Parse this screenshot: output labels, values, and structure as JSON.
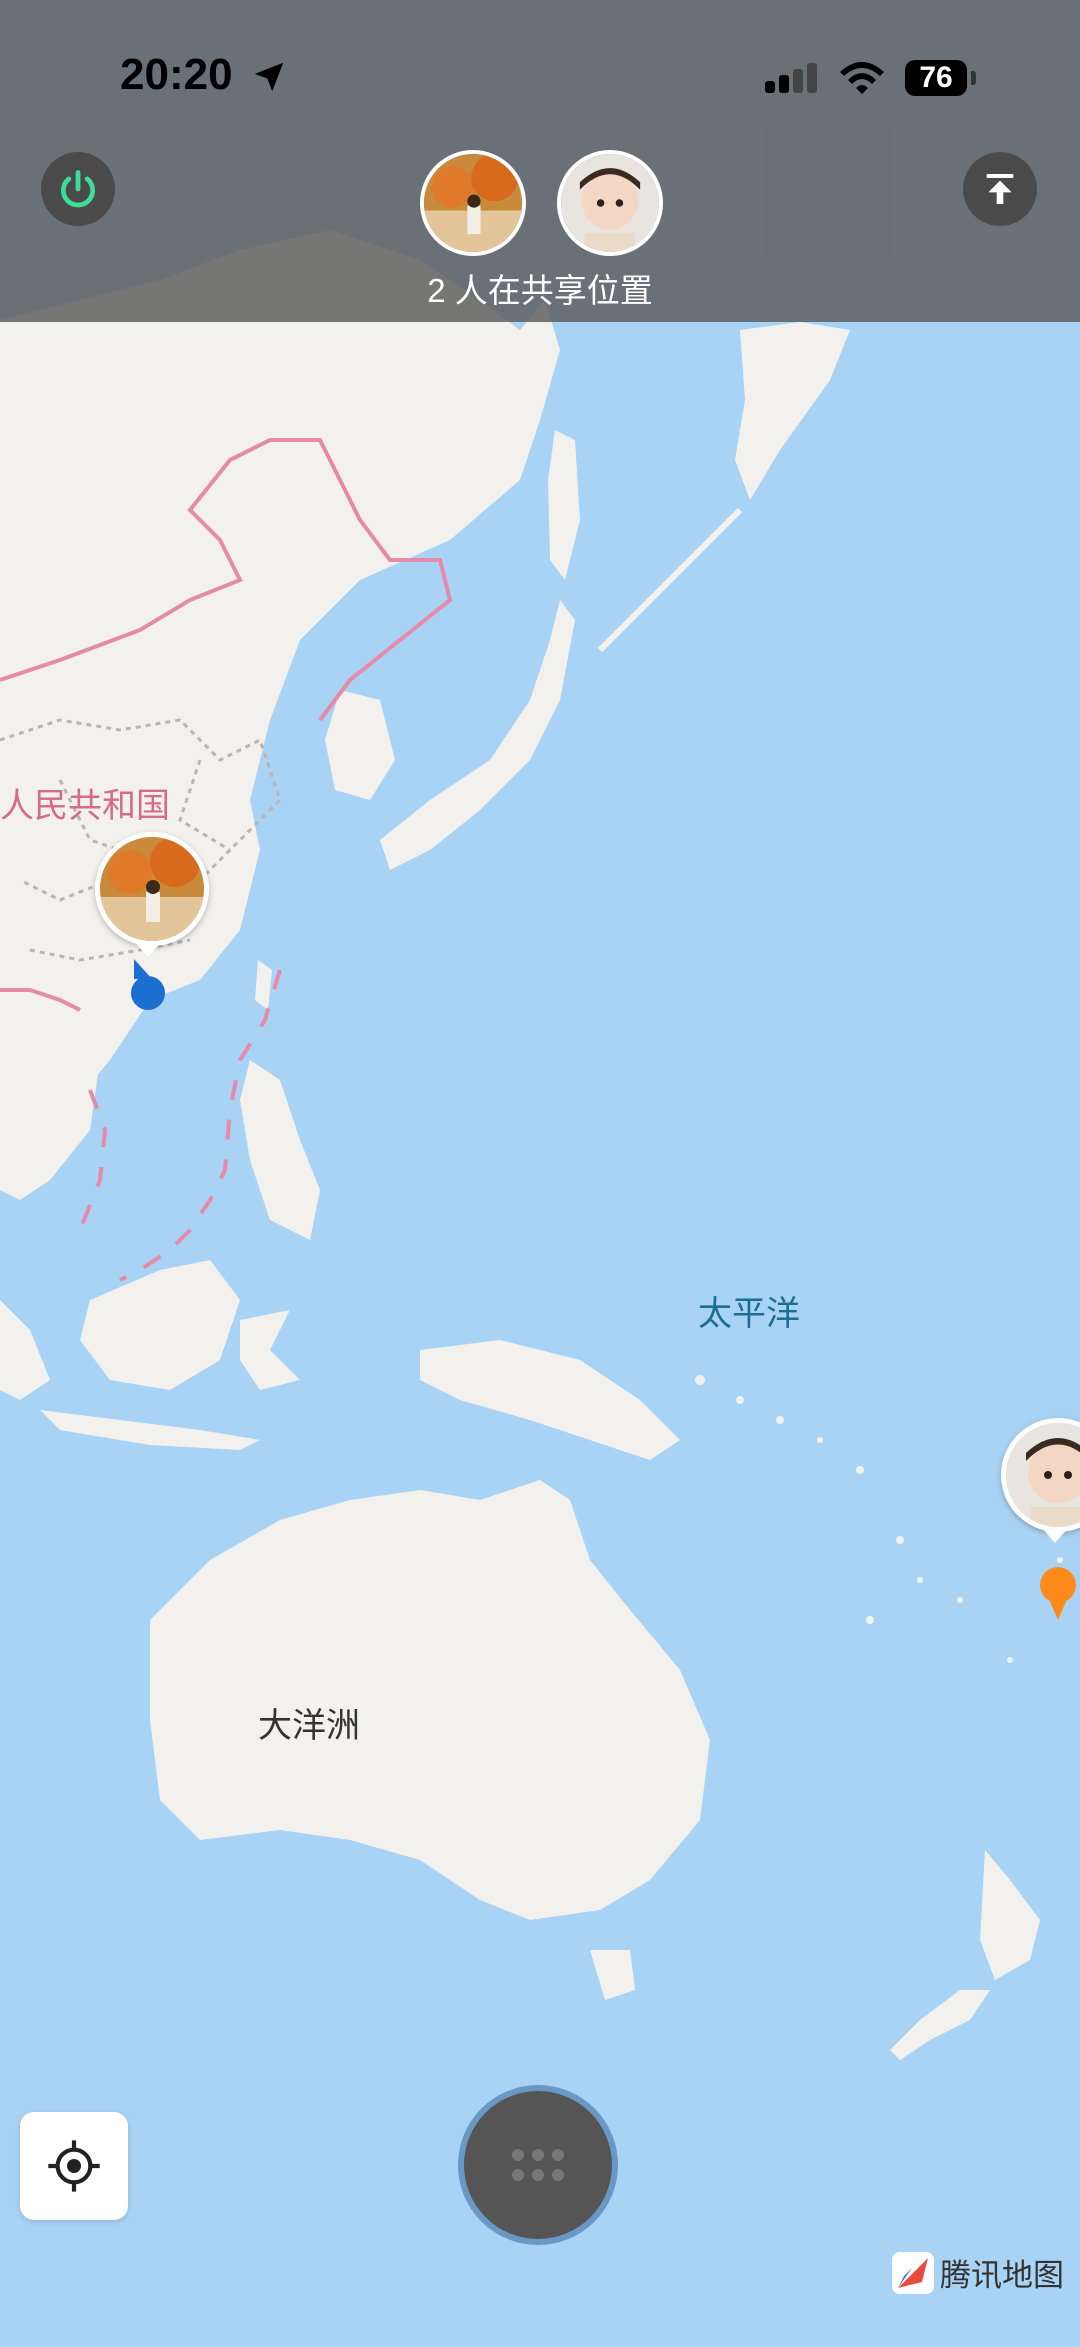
{
  "status_bar": {
    "time": "20:20",
    "battery": "76"
  },
  "top_panel": {
    "share_text": "2 人在共享位置",
    "power_icon": "power-icon",
    "upload_icon": "upload-top-icon"
  },
  "map": {
    "labels": {
      "china": "人民共和国",
      "pacific": "太平洋",
      "oceania": "大洋洲"
    },
    "brand": "腾讯地图"
  },
  "colors": {
    "ocean": "#a9d3f4",
    "land": "#f3f1ee",
    "border": "#e58aa8",
    "power_accent": "#3ddc97",
    "self_dot": "#1b6fd0",
    "friend_pin": "#ff8a1c"
  }
}
